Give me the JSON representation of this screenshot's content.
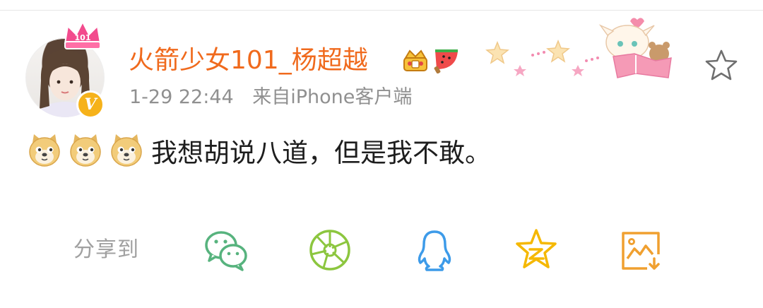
{
  "post": {
    "username": "火箭少女101_杨超越",
    "time": "1-29 22:44",
    "source": "来自iPhone客户端",
    "text": "我想胡说八道，但是我不敢。",
    "emojis": [
      "doge-icon",
      "doge-icon",
      "doge-icon"
    ],
    "badges": [
      "crown-badge-icon",
      "watermelon-badge-icon"
    ]
  },
  "share": {
    "label": "分享到",
    "targets": [
      "wechat-icon",
      "moments-icon",
      "qq-icon",
      "qzone-icon",
      "save-image-icon"
    ]
  },
  "colors": {
    "username": "#f06a1d",
    "meta": "#909090",
    "text": "#1e1e1e",
    "wechat": "#57b37e",
    "moments": "#8cc63f",
    "qq": "#3d9be9",
    "qzone": "#f5b800",
    "save": "#f0a030"
  }
}
